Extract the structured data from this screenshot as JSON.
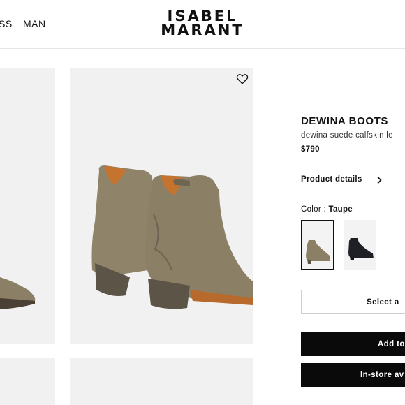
{
  "nav": {
    "left_items": [
      "SS",
      "MAN"
    ],
    "logo_line1": "ISABEL",
    "logo_line2": "MARANT"
  },
  "product": {
    "title": "DEWINA BOOTS",
    "subtitle": "dewina suede calfskin le",
    "price": "$790",
    "details_link": "Product details",
    "color_label": "Color : ",
    "color_value": "Taupe",
    "swatches": [
      {
        "name": "Taupe",
        "selected": true
      },
      {
        "name": "Black",
        "selected": false
      }
    ],
    "select_size_label": "Select a",
    "add_to_bag_label": "Add to",
    "in_store_label": "In-store av"
  },
  "colors": {
    "taupe": "#8b7f66",
    "black_button": "#0a0a0a",
    "tile_bg": "#f1f1f1"
  },
  "icons": [
    "heart-icon",
    "chevron-right-icon"
  ]
}
